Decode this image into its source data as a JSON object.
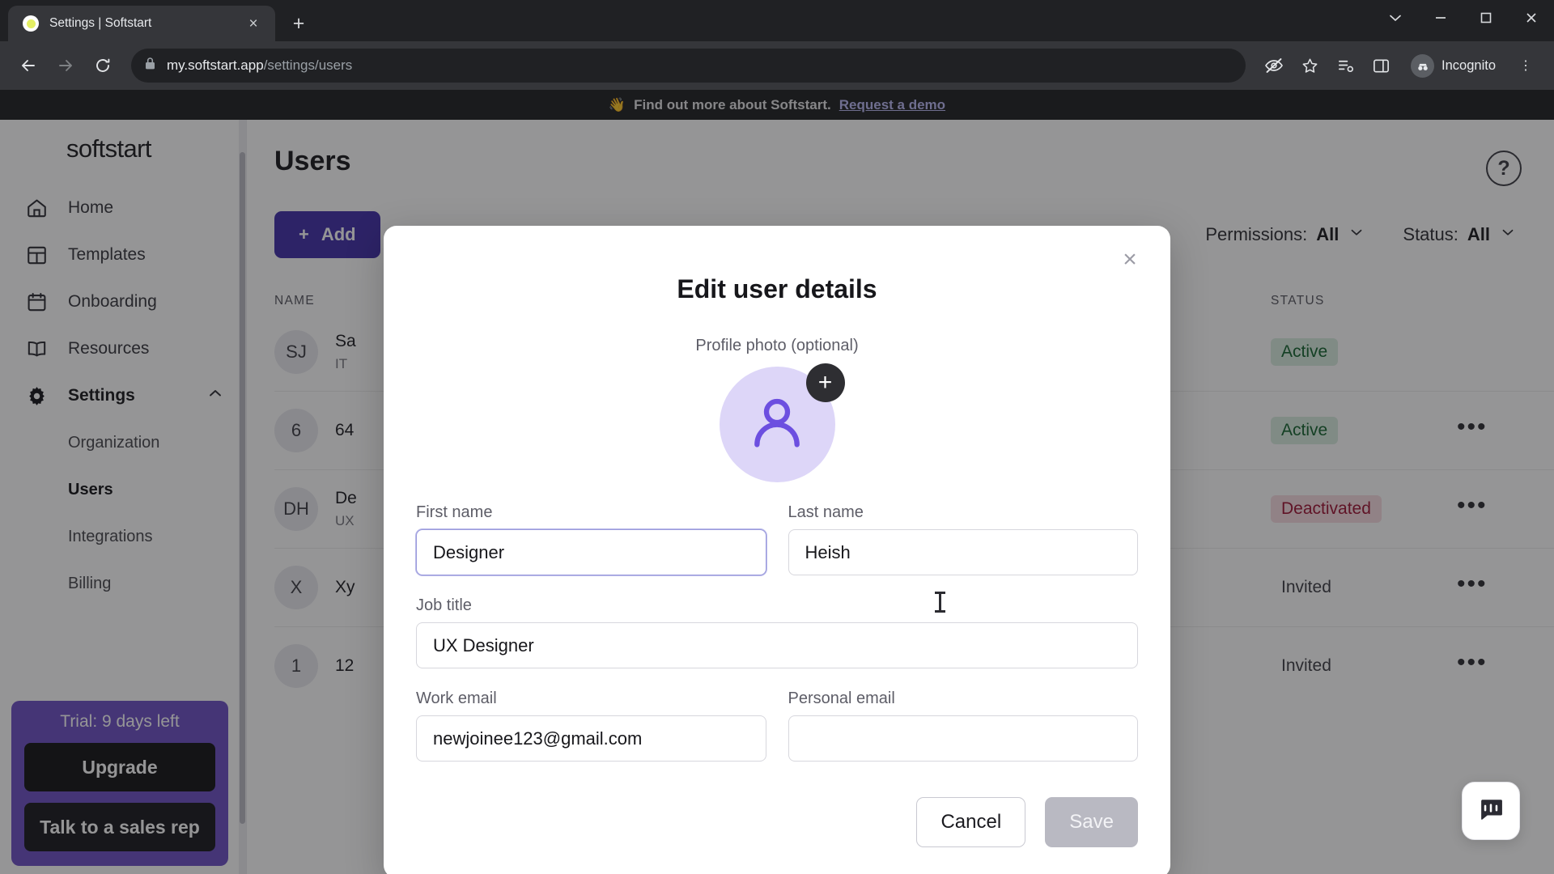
{
  "browser": {
    "tab": {
      "title": "Settings | Softstart",
      "favicon_name": "softstart-favicon",
      "close_label": "×"
    },
    "new_tab_label": "+",
    "window_controls": {
      "minimize": "—",
      "maximize": "□",
      "close": "✕",
      "collapse": "⌄"
    },
    "nav": {
      "back": "←",
      "forward": "→",
      "reload": "↻"
    },
    "omnibox": {
      "lock_icon": "lock-icon",
      "host": "my.softstart.app",
      "path": "/settings/users"
    },
    "toolbar_icons": [
      "incognito-eye-icon",
      "bookmark-star-icon",
      "reading-list-icon",
      "side-panel-icon"
    ],
    "profile": {
      "label": "Incognito",
      "avatar_name": "incognito-avatar"
    },
    "menu_label": "⋮"
  },
  "banner": {
    "emoji": "👋",
    "text": "Find out more about Softstart.",
    "link": "Request a demo"
  },
  "sidebar": {
    "logo": "softstart",
    "items": [
      {
        "label": "Home",
        "icon": "home-icon"
      },
      {
        "label": "Templates",
        "icon": "templates-icon"
      },
      {
        "label": "Onboarding",
        "icon": "calendar-icon"
      },
      {
        "label": "Resources",
        "icon": "book-icon"
      },
      {
        "label": "Settings",
        "icon": "gear-icon",
        "expanded": true,
        "chevron": "chevron-up-icon"
      }
    ],
    "subitems": [
      {
        "label": "Organization",
        "selected": false
      },
      {
        "label": "Users",
        "selected": true
      },
      {
        "label": "Integrations",
        "selected": false
      },
      {
        "label": "Billing",
        "selected": false
      }
    ],
    "trial": {
      "label": "Trial: 9 days left",
      "upgrade_label": "Upgrade",
      "sales_label": "Talk to a sales rep"
    }
  },
  "main": {
    "title": "Users",
    "help_label": "?",
    "add_button": {
      "plus": "+",
      "label": "Add"
    },
    "filters": [
      {
        "name": "Permissions",
        "label": "Permissions:",
        "value": "All",
        "chevron": "chevron-down-icon"
      },
      {
        "name": "Status",
        "label": "Status:",
        "value": "All",
        "chevron": "chevron-down-icon"
      }
    ],
    "table": {
      "columns": [
        "NAME",
        "STATUS"
      ],
      "rows": [
        {
          "initials": "SJ",
          "name": "Sa",
          "subtitle": "IT",
          "status": "Active",
          "status_kind": "active",
          "menu": "•••",
          "menu_visible": false
        },
        {
          "initials": "6",
          "name": "64",
          "subtitle": "",
          "status": "Active",
          "status_kind": "active",
          "menu": "•••",
          "menu_visible": true
        },
        {
          "initials": "DH",
          "name": "De",
          "subtitle": "UX",
          "status": "Deactivated",
          "status_kind": "deactivated",
          "menu": "•••",
          "menu_visible": true
        },
        {
          "initials": "X",
          "name": "Xy",
          "subtitle": "",
          "status": "Invited",
          "status_kind": "invited",
          "menu": "•••",
          "menu_visible": true
        },
        {
          "initials": "1",
          "name": "12",
          "subtitle": "",
          "status": "Invited",
          "status_kind": "invited",
          "menu": "•••",
          "menu_visible": true
        }
      ]
    }
  },
  "modal": {
    "title": "Edit user details",
    "close_label": "×",
    "photo_label": "Profile photo (optional)",
    "avatar_plus": "+",
    "avatar_icon": "person-icon",
    "fields": {
      "first_name": {
        "label": "First name",
        "value": "Designer",
        "placeholder": "",
        "focused": true
      },
      "last_name": {
        "label": "Last name",
        "value": "Heish",
        "placeholder": "",
        "focused": false
      },
      "job_title": {
        "label": "Job title",
        "value": "UX Designer",
        "placeholder": "",
        "focused": false
      },
      "work_email": {
        "label": "Work email",
        "value": "newjoinee123@gmail.com",
        "placeholder": "",
        "focused": false
      },
      "personal_email": {
        "label": "Personal email",
        "value": "",
        "placeholder": "",
        "focused": false
      }
    },
    "cancel_label": "Cancel",
    "save_label": "Save",
    "save_disabled": true
  },
  "chat": {
    "icon": "intercom-chat-icon"
  },
  "colors": {
    "accent_purple": "#3f2ea8",
    "trial_purple": "#6c4fc4",
    "active_green": "#12632e",
    "deactivated_red": "#9e1133",
    "avatar_lavender": "#ddd6f8"
  }
}
